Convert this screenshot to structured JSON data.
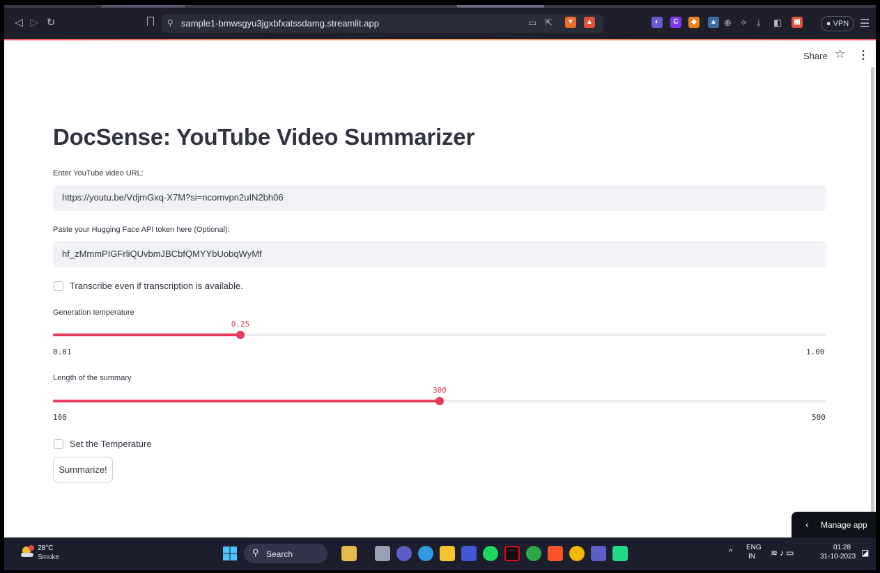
{
  "browser": {
    "url": "sample1-bmwsgyu3jgxbfxatssdamg.streamlit.app",
    "vpn_label": "VPN"
  },
  "header": {
    "share_label": "Share"
  },
  "main": {
    "title": "DocSense: YouTube Video Summarizer",
    "url_field": {
      "label": "Enter YouTube video URL:",
      "value": "https://youtu.be/VdjmGxq-X7M?si=ncomvpn2uIN2bh06"
    },
    "token_field": {
      "label": "Paste your Hugging Face API token here (Optional):",
      "value": "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"
    },
    "transcribe_checkbox": {
      "label": "Transcribe even if transcription is available.",
      "checked": false
    },
    "temperature_slider": {
      "label": "Generation temperature",
      "value": "0.25",
      "min": "0.01",
      "max": "1.00",
      "fraction": 0.2424
    },
    "length_slider": {
      "label": "Length of the summary",
      "value": "300",
      "min": "100",
      "max": "500",
      "fraction": 0.5
    },
    "set_temperature_checkbox": {
      "label": "Set the Temperature",
      "checked": false
    },
    "summarize_button": "Summarize!",
    "manage_app_label": "Manage app"
  },
  "taskbar": {
    "weather_temp": "28°C",
    "weather_desc": "Smoke",
    "search_label": "Search",
    "language_1": "ENG",
    "language_2": "IN",
    "time": "01:28",
    "date": "31-10-2023"
  },
  "colors": {
    "accent": "#e83a5f",
    "text": "#31333f",
    "input_bg": "#f0f2f6",
    "taskbar": "#1c1e2e",
    "browser_bar": "#1e1f2b"
  }
}
